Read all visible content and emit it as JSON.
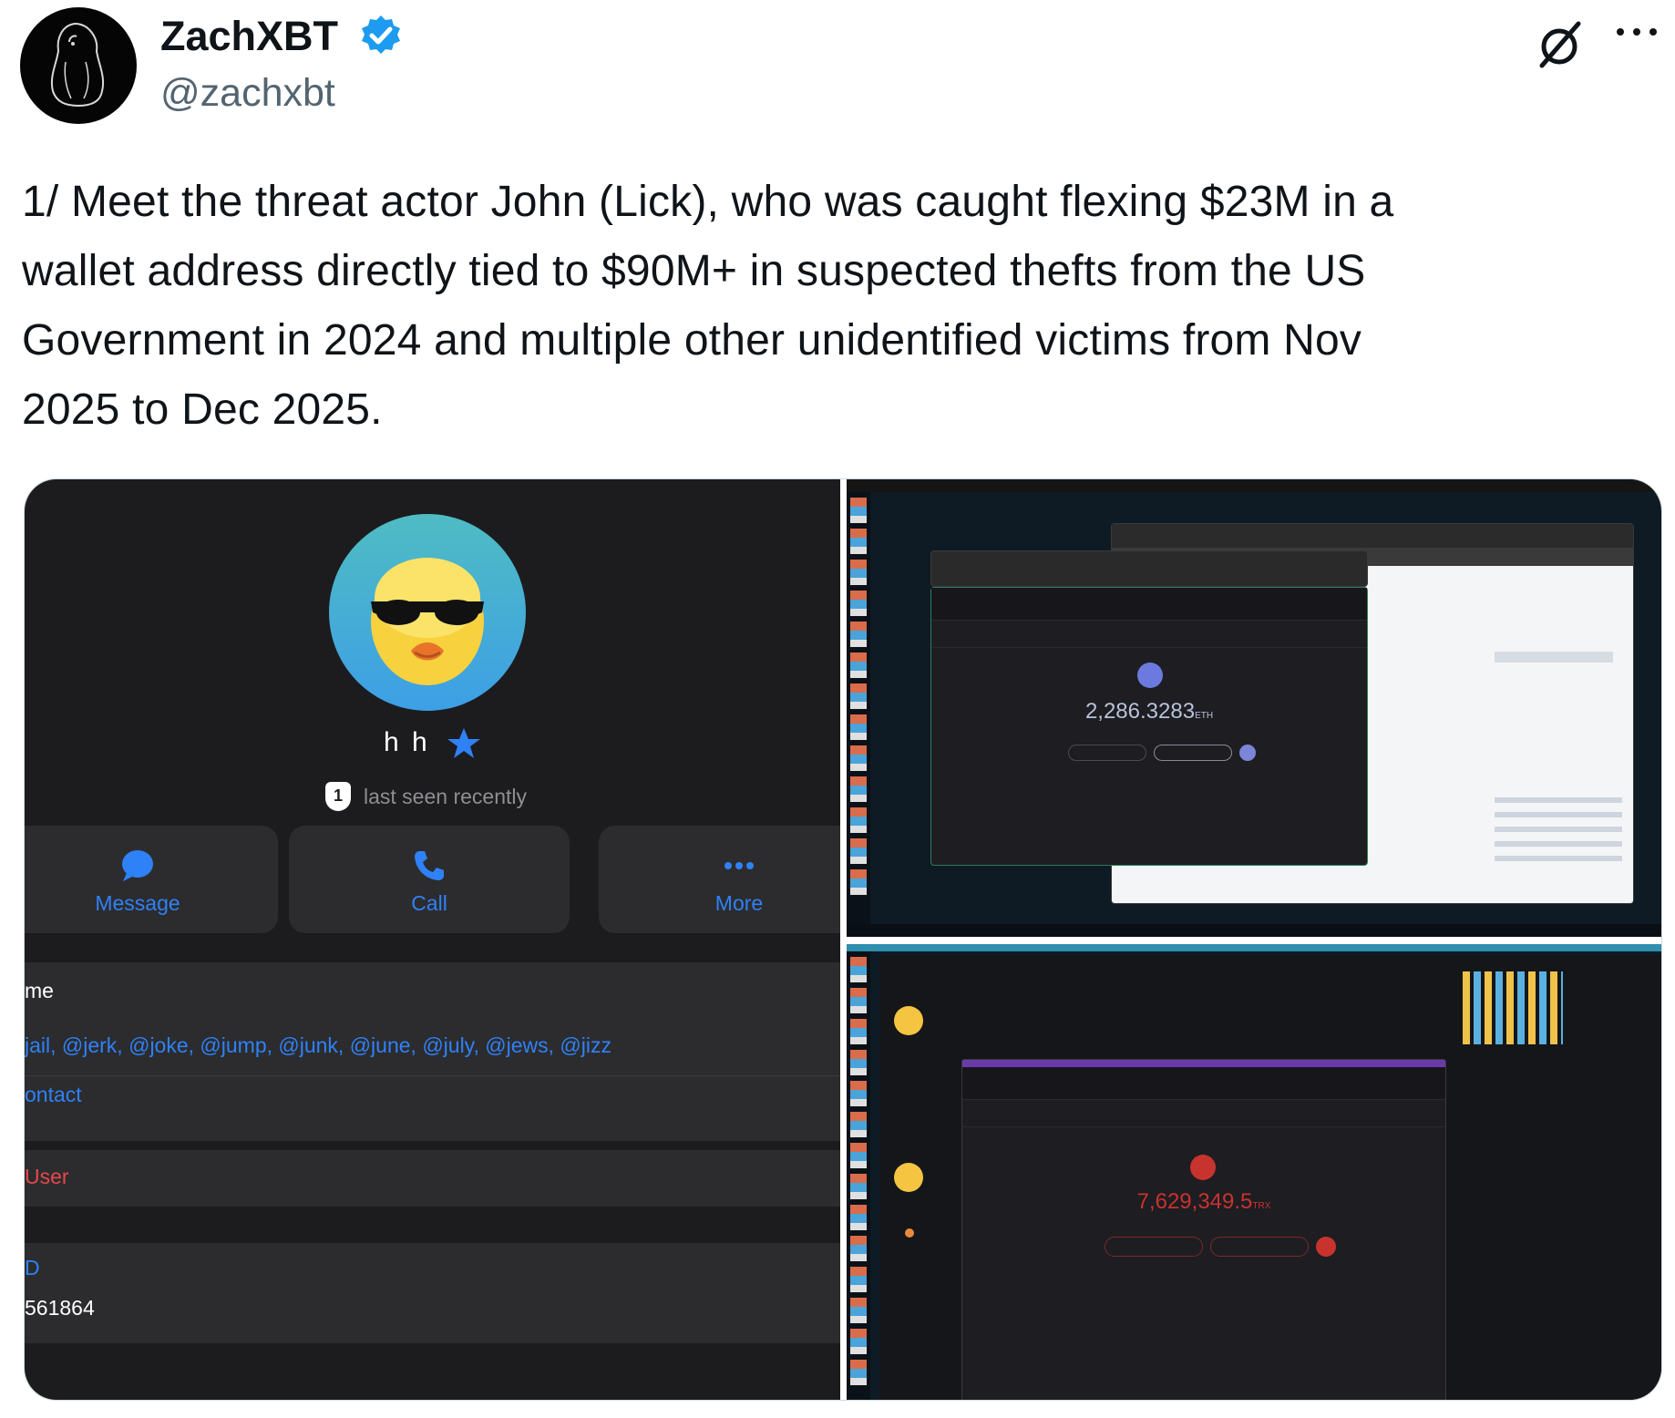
{
  "tweet": {
    "author_name": "ZachXBT",
    "handle": "@zachxbt",
    "text": "1/ Meet the threat actor John (Lick), who was caught flexing $23M in a\nwallet address directly tied to $90M+  in suspected thefts from the US\nGovernment in 2024 and multiple other unidentified victims from Nov\n2025 to Dec 2025."
  },
  "icons": {
    "verified": "verified-badge-icon",
    "grok": "grok-icon",
    "more": "more-icon"
  },
  "profile": {
    "name": "h h",
    "status_badge": "1",
    "status": "last seen recently",
    "actions": [
      {
        "label": "Message"
      },
      {
        "label": "Call"
      },
      {
        "label": "More"
      }
    ],
    "username_header": "me",
    "usernames": "jail, @jerk, @joke, @jump, @junk, @june, @july, @jews, @jizz",
    "contact_label": "ontact",
    "user_label": "User",
    "id_label": "D",
    "id_value": "561864"
  },
  "wallet_top": {
    "balance": "2,286.3283",
    "unit": "ETH"
  },
  "wallet_bottom": {
    "balance": "7,629,349.5",
    "unit": "TRX"
  },
  "colors": {
    "accent": "#1d9bf0",
    "telegram_blue": "#2f81f7",
    "danger": "#e5484d"
  }
}
